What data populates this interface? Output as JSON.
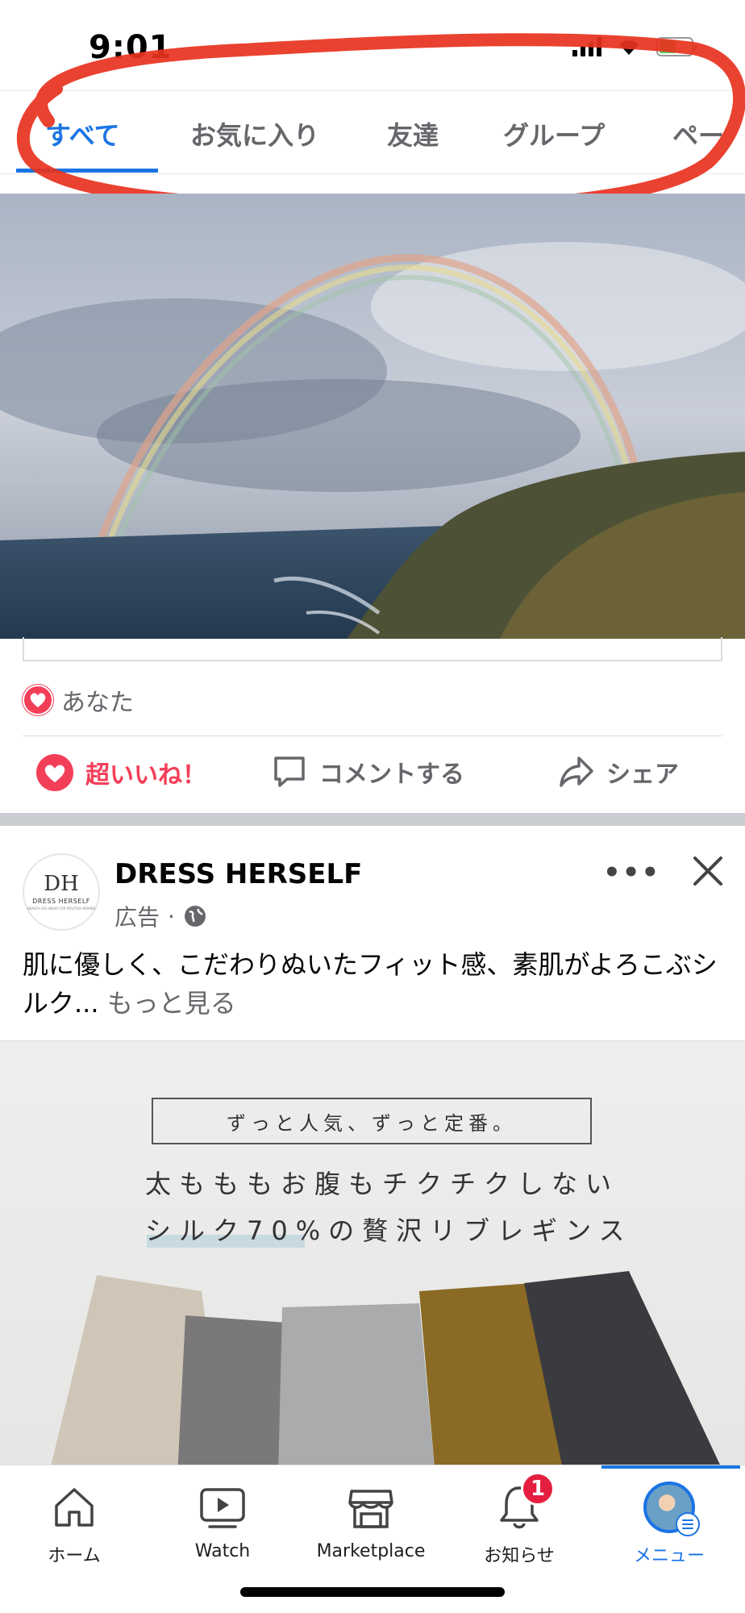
{
  "status_bar": {
    "time": "9:01"
  },
  "tabs": [
    {
      "label": "すべて"
    },
    {
      "label": "お気に入り"
    },
    {
      "label": "友達"
    },
    {
      "label": "グループ"
    },
    {
      "label": "ペー"
    }
  ],
  "post": {
    "reaction_text": "あなた",
    "actions": {
      "love": "超いいね！",
      "comment": "コメントする",
      "share": "シェア"
    }
  },
  "ad": {
    "avatar_monogram": "DH",
    "avatar_brand": "DRESS HERSELF",
    "avatar_tagline": "HEALTH LIFE WEAR FOR POSITIVE WOMEN",
    "name": "DRESS HERSELF",
    "meta_label": "広告",
    "body_text": "肌に優しく、こだわりぬいたフィット感、素肌がよろこぶシルク...",
    "see_more": "もっと見る",
    "image_box_text": "ずっと人気、ずっと定番。",
    "image_headline_1": "太もももお腹もチクチクしない",
    "image_headline_2": "シルク70%の贅沢リブレギンス",
    "product_colors": [
      "#cfc6b8",
      "#7a7878",
      "#a9abad",
      "#8a6a25",
      "#3a3b3f"
    ]
  },
  "bottom_nav": [
    {
      "label": "ホーム",
      "icon": "home-icon"
    },
    {
      "label": "Watch",
      "icon": "watch-icon"
    },
    {
      "label": "Marketplace",
      "icon": "marketplace-icon"
    },
    {
      "label": "お知らせ",
      "icon": "bell-icon",
      "badge": "1"
    },
    {
      "label": "メニュー",
      "icon": "menu-avatar",
      "active": true
    }
  ],
  "colors": {
    "accent": "#1b74e4",
    "love": "#f33e58",
    "annotation": "#e8321e"
  }
}
